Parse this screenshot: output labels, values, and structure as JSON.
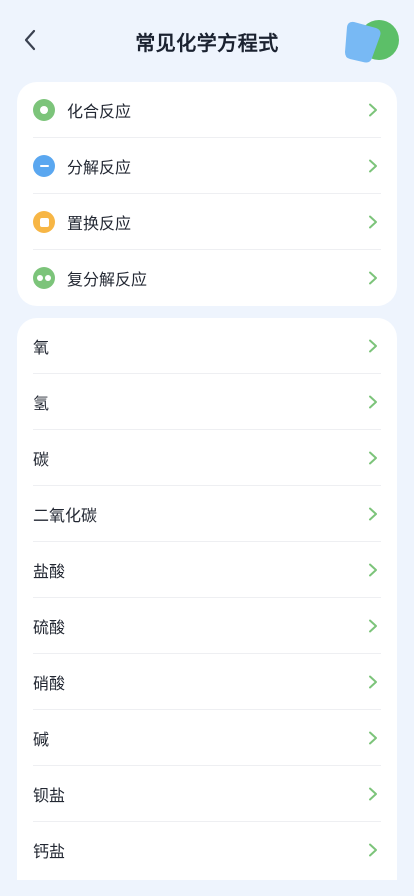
{
  "header": {
    "title": "常见化学方程式"
  },
  "colors": {
    "accent_green": "#7cc47a",
    "blue": "#5aa7f0",
    "orange": "#f7b645",
    "background": "#eef4fd"
  },
  "reactions": [
    {
      "label": "化合反应",
      "icon": "circle-dot-icon"
    },
    {
      "label": "分解反应",
      "icon": "minus-circle-icon"
    },
    {
      "label": "置换反应",
      "icon": "square-circle-icon"
    },
    {
      "label": "复分解反应",
      "icon": "double-dot-icon"
    }
  ],
  "elements": [
    {
      "label": "氧"
    },
    {
      "label": "氢"
    },
    {
      "label": "碳"
    },
    {
      "label": "二氧化碳"
    },
    {
      "label": "盐酸"
    },
    {
      "label": "硫酸"
    },
    {
      "label": "硝酸"
    },
    {
      "label": "碱"
    },
    {
      "label": "钡盐"
    },
    {
      "label": "钙盐"
    }
  ]
}
